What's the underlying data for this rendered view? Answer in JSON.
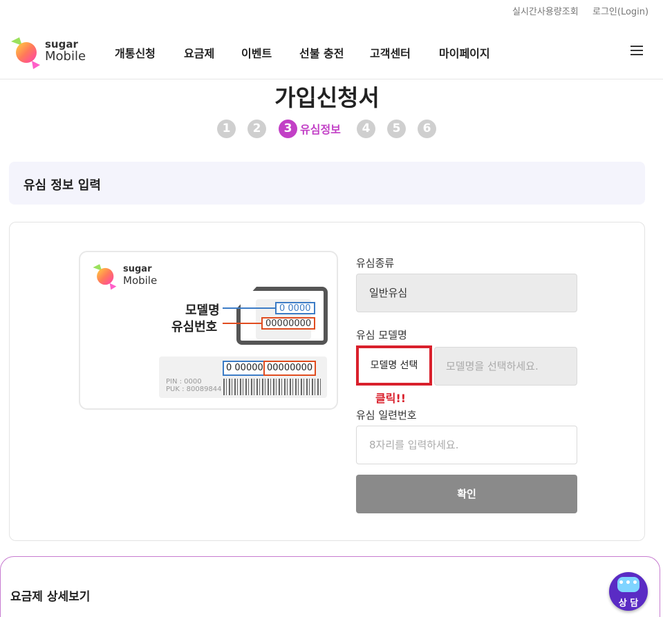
{
  "utility": {
    "realtime_usage": "실시간사용량조회",
    "login": "로그인(Login)"
  },
  "logo": {
    "line1": "sugar",
    "line2": "Mobile"
  },
  "nav": {
    "items": [
      "개통신청",
      "요금제",
      "이벤트",
      "선불 충전",
      "고객센터",
      "마이페이지"
    ]
  },
  "page": {
    "title": "가입신청서"
  },
  "steps": {
    "numbers": [
      "1",
      "2",
      "3",
      "4",
      "5",
      "6"
    ],
    "active_index": 3,
    "active_label": "유심정보"
  },
  "section": {
    "title": "유심 정보 입력"
  },
  "sim_card": {
    "logo_line1": "sugar",
    "logo_line2": "Mobile",
    "model_label": "모델명",
    "serial_label": "유심번호",
    "model_code": "0 0000",
    "serial_code": "00000000",
    "bottom_model_code": "0 000000",
    "bottom_serial_code": "00000000",
    "pin": "PIN  : 0000",
    "puk": "PUK : 80089844"
  },
  "form": {
    "sim_type_label": "유심종류",
    "sim_type_value": "일반유심",
    "sim_model_label": "유심 모델명",
    "model_select_button": "모델명 선택",
    "model_placeholder": "모델명을 선택하세요.",
    "click_note": "클릭!!",
    "serial_label": "유심 일련번호",
    "serial_placeholder": "8자리를 입력하세요.",
    "confirm_button": "확인"
  },
  "plan_panel": {
    "title": "요금제 상세보기"
  },
  "consult": {
    "label": "상 담"
  },
  "colors": {
    "accent": "#c240c6",
    "highlight_red": "#d9202c",
    "confirm_gray": "#8a8a8a"
  }
}
